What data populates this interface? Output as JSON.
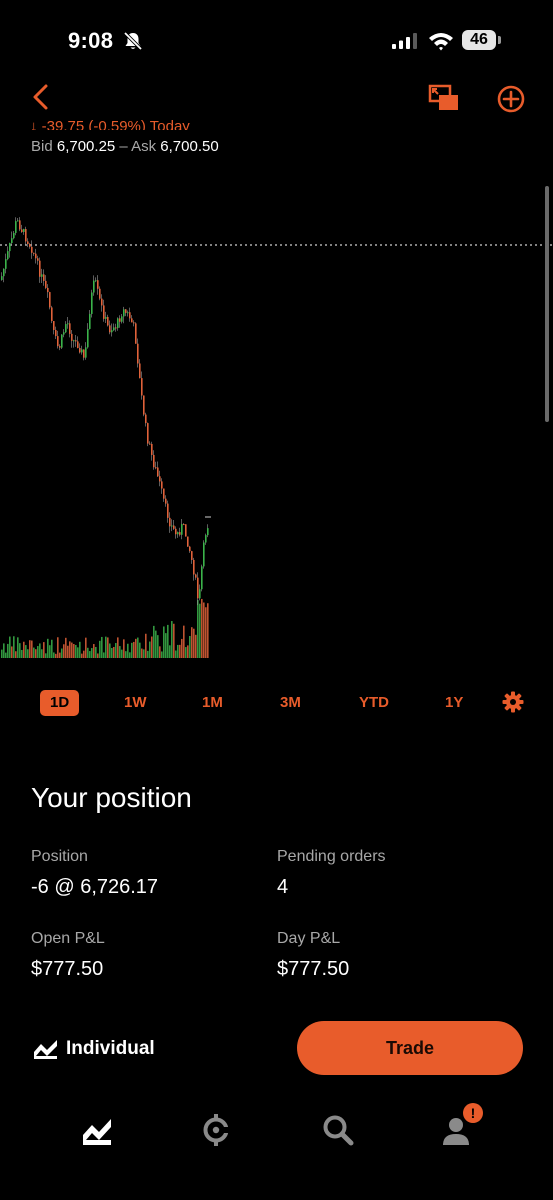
{
  "status_bar": {
    "time": "9:08",
    "battery": "46"
  },
  "quote": {
    "change_text": "↓ -39.75 (-0.59%) Today",
    "bid_label": "Bid",
    "bid": "6,700.25",
    "separator": "–",
    "ask_label": "Ask",
    "ask": "6,700.50"
  },
  "timeframes": [
    "1D",
    "1W",
    "1M",
    "3M",
    "YTD",
    "1Y"
  ],
  "timeframe_selected": "1D",
  "position": {
    "title": "Your position",
    "position_label": "Position",
    "position_value": "-6 @ 6,726.17",
    "pending_label": "Pending orders",
    "pending_value": "4",
    "open_pnl_label": "Open P&L",
    "open_pnl_value": "$777.50",
    "day_pnl_label": "Day P&L",
    "day_pnl_value": "$777.50"
  },
  "account": {
    "name": "Individual"
  },
  "trade_button": {
    "label": "Trade"
  },
  "nav": {
    "items": [
      "chart-nav-icon",
      "crypto-nav-icon",
      "search-nav-icon",
      "account-nav-icon"
    ],
    "account_badge": "!"
  },
  "colors": {
    "accent": "#e85c2b",
    "up": "#3bb34a",
    "down": "#e0623a",
    "background": "#000000",
    "muted": "#a8a8a8"
  }
}
